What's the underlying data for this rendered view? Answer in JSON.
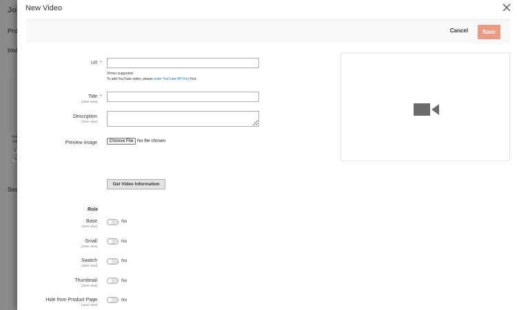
{
  "background": {
    "texts": [
      "Jou",
      "Pro",
      "Ima",
      "Sea"
    ],
    "small_texts": [
      "Ima",
      "108"
    ],
    "boxes": [
      "B",
      "Th"
    ]
  },
  "modal": {
    "title": "New Video",
    "cancel_label": "Cancel",
    "save_label": "Save"
  },
  "form": {
    "url": {
      "label": "Url",
      "value": "",
      "note_line1": "Vimeo supported.",
      "note_line2_before": "To add YouTube video, please ",
      "note_link": "enter YouTube API Key",
      "note_line2_after": " first."
    },
    "title": {
      "label": "Title",
      "scope": "[store view]",
      "value": ""
    },
    "description": {
      "label": "Description",
      "scope": "[store view]",
      "value": ""
    },
    "preview_image": {
      "label": "Preview Image",
      "button": "Choose File",
      "status": "No file chosen"
    },
    "get_info_button": "Get Video Information",
    "role": {
      "title": "Role",
      "items": [
        {
          "label": "Base",
          "scope": "[store view]",
          "value": "No"
        },
        {
          "label": "Small",
          "scope": "[store view]",
          "value": "No"
        },
        {
          "label": "Swatch",
          "scope": "[store view]",
          "value": "No"
        },
        {
          "label": "Thumbnail",
          "scope": "[store view]",
          "value": "No"
        },
        {
          "label": "Hide from Product Page",
          "scope": "[store view]",
          "value": "No"
        }
      ]
    }
  },
  "preview": {
    "icon": "video-camera-icon"
  },
  "colors": {
    "save": "#eb9b81",
    "link": "#1979c3",
    "required": "#e02b27"
  }
}
